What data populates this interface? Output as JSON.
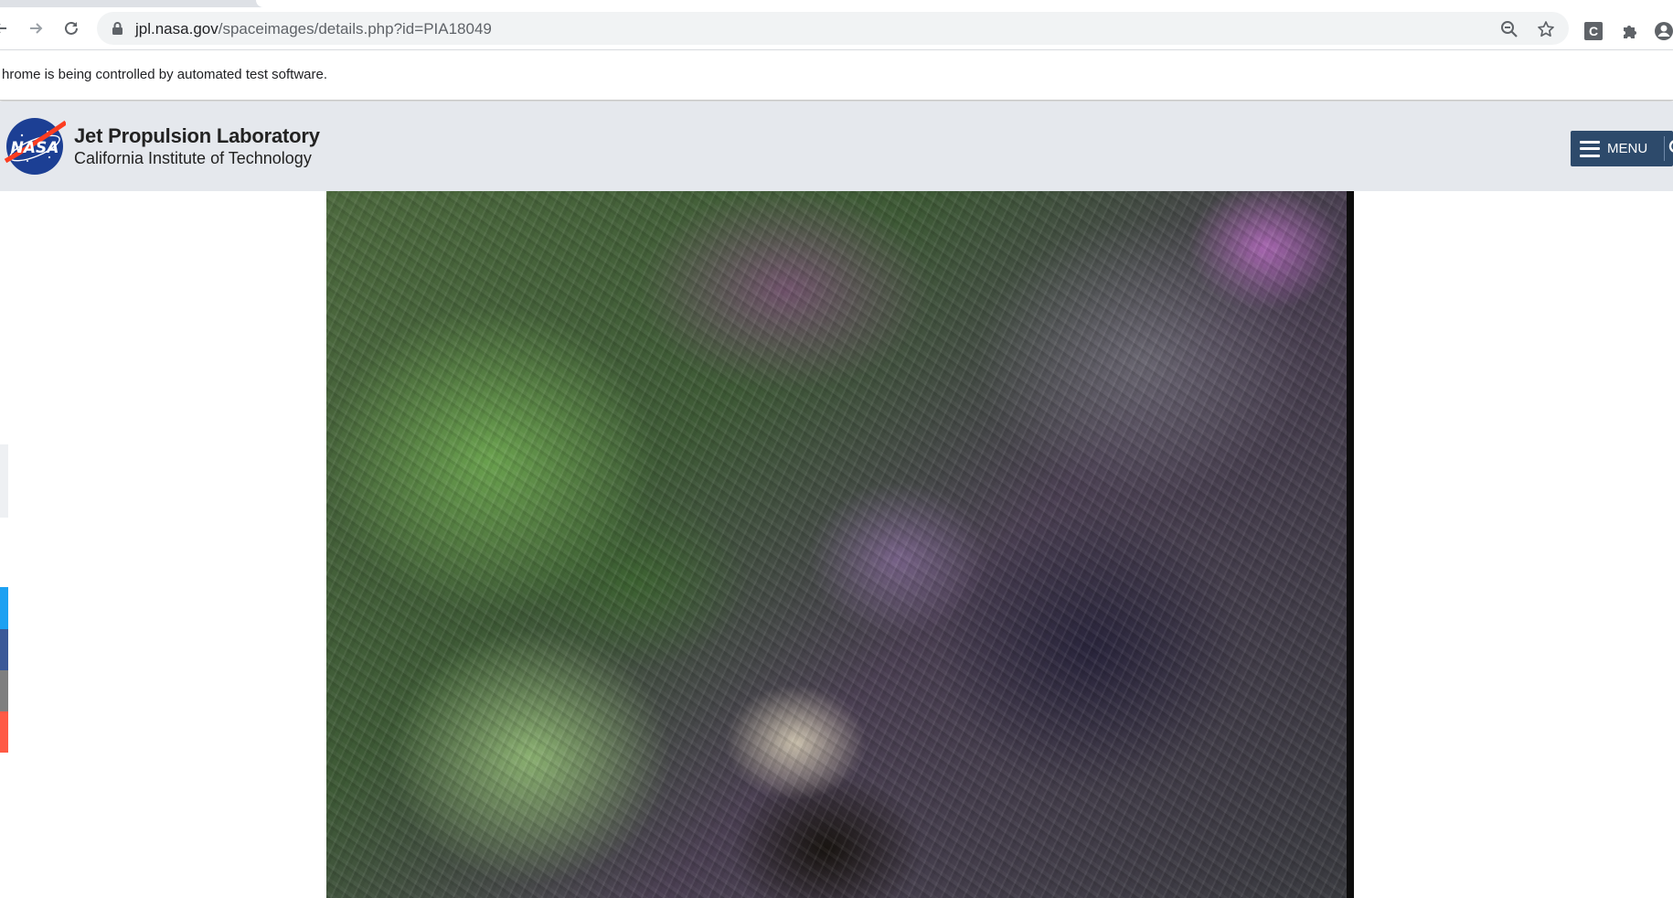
{
  "browser": {
    "url_domain": "jpl.nasa.gov",
    "url_path": "/spaceimages/details.php?id=PIA18049",
    "automation_notice": "hrome is being controlled by automated test software.",
    "extension_letter": "C"
  },
  "site": {
    "lab_name": "Jet Propulsion Laboratory",
    "institution": "California Institute of Technology",
    "logo_text": "NASA",
    "menu_label": "MENU"
  },
  "colors": {
    "header_bg": "#e5e8ed",
    "menu_bg": "#2d4a6b",
    "share_twitter": "#1da1f2",
    "share_facebook": "#3b5998",
    "share_email": "#7f7f7f",
    "share_reddit": "#ff5a45"
  },
  "icons": {
    "back": "arrow-left",
    "forward": "arrow-right",
    "reload": "reload",
    "lock": "lock",
    "zoom": "magnifier-minus",
    "bookmark": "star",
    "extensions": "puzzle",
    "profile": "person-circle",
    "menu": "hamburger",
    "search": "magnifier"
  }
}
